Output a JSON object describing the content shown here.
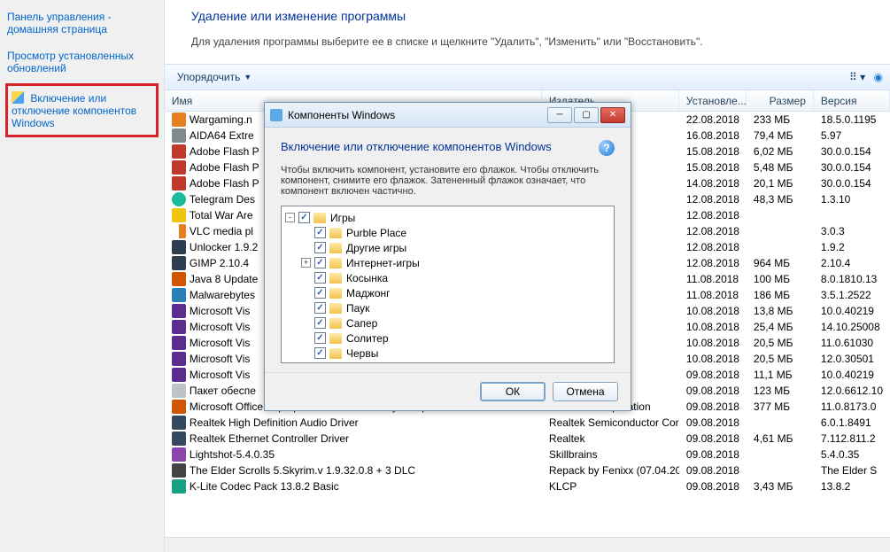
{
  "sidebar": {
    "home": "Панель управления - домашняя страница",
    "updates": "Просмотр установленных обновлений",
    "features": "Включение или отключение компонентов Windows"
  },
  "page": {
    "heading": "Удаление или изменение программы",
    "subhead": "Для удаления программы выберите ее в списке и щелкните \"Удалить\", \"Изменить\" или \"Восстановить\"."
  },
  "toolbar": {
    "organize": "Упорядочить"
  },
  "columns": {
    "name": "Имя",
    "publisher": "Издатель",
    "date": "Установле...",
    "size": "Размер",
    "version": "Версия"
  },
  "programs": [
    {
      "ico": "ic-orange",
      "name": "Wargaming.n",
      "pub": "",
      "date": "22.08.2018",
      "size": "233 МБ",
      "ver": "18.5.0.1195"
    },
    {
      "ico": "ic-grey",
      "name": "AIDA64 Extre",
      "pub": "",
      "date": "16.08.2018",
      "size": "79,4 МБ",
      "ver": "5.97"
    },
    {
      "ico": "ic-red",
      "name": "Adobe Flash P",
      "pub": "ated",
      "date": "15.08.2018",
      "size": "6,02 МБ",
      "ver": "30.0.0.154"
    },
    {
      "ico": "ic-red",
      "name": "Adobe Flash P",
      "pub": "",
      "date": "15.08.2018",
      "size": "5,48 МБ",
      "ver": "30.0.0.154"
    },
    {
      "ico": "ic-red",
      "name": "Adobe Flash P",
      "pub": "ated",
      "date": "14.08.2018",
      "size": "20,1 МБ",
      "ver": "30.0.0.154"
    },
    {
      "ico": "ic-teal",
      "name": "Telegram Des",
      "pub": "",
      "date": "12.08.2018",
      "size": "48,3 МБ",
      "ver": "1.3.10"
    },
    {
      "ico": "ic-yellow",
      "name": "Total War Are",
      "pub": "",
      "date": "12.08.2018",
      "size": "",
      "ver": ""
    },
    {
      "ico": "ic-vlc",
      "name": "VLC media pl",
      "pub": "",
      "date": "12.08.2018",
      "size": "",
      "ver": "3.0.3"
    },
    {
      "ico": "ic-dark",
      "name": "Unlocker 1.9.2",
      "pub": "",
      "date": "12.08.2018",
      "size": "",
      "ver": "1.9.2"
    },
    {
      "ico": "ic-dark",
      "name": "GIMP 2.10.4",
      "pub": "",
      "date": "12.08.2018",
      "size": "964 МБ",
      "ver": "2.10.4"
    },
    {
      "ico": "ic-java",
      "name": "Java 8 Update",
      "pub": "",
      "date": "11.08.2018",
      "size": "100 МБ",
      "ver": "8.0.1810.13"
    },
    {
      "ico": "ic-mwb",
      "name": "Malwarebytes",
      "pub": "",
      "date": "11.08.2018",
      "size": "186 МБ",
      "ver": "3.5.1.2522"
    },
    {
      "ico": "ic-vs",
      "name": "Microsoft Vis",
      "pub": "",
      "date": "10.08.2018",
      "size": "13,8 МБ",
      "ver": "10.0.40219"
    },
    {
      "ico": "ic-vs",
      "name": "Microsoft Vis",
      "pub": "",
      "date": "10.08.2018",
      "size": "25,4 МБ",
      "ver": "14.10.25008"
    },
    {
      "ico": "ic-vs",
      "name": "Microsoft Vis",
      "pub": "",
      "date": "10.08.2018",
      "size": "20,5 МБ",
      "ver": "11.0.61030"
    },
    {
      "ico": "ic-vs",
      "name": "Microsoft Vis",
      "pub": "фт",
      "date": "10.08.2018",
      "size": "20,5 МБ",
      "ver": "12.0.30501"
    },
    {
      "ico": "ic-vs",
      "name": "Microsoft Vis",
      "pub": "",
      "date": "09.08.2018",
      "size": "11,1 МБ",
      "ver": "10.0.40219"
    },
    {
      "ico": "ic-generic",
      "name": "Пакет обеспе",
      "pub": "",
      "date": "09.08.2018",
      "size": "123 МБ",
      "ver": "12.0.6612.10"
    },
    {
      "ico": "ic-office",
      "name": "Microsoft Office - профессиональный выпуск версии 2003",
      "pub": "Microsoft Corporation",
      "date": "09.08.2018",
      "size": "377 МБ",
      "ver": "11.0.8173.0"
    },
    {
      "ico": "ic-realtek",
      "name": "Realtek High Definition Audio Driver",
      "pub": "Realtek Semiconductor Corp.",
      "date": "09.08.2018",
      "size": "",
      "ver": "6.0.1.8491"
    },
    {
      "ico": "ic-realtek",
      "name": "Realtek Ethernet Controller Driver",
      "pub": "Realtek",
      "date": "09.08.2018",
      "size": "4,61 МБ",
      "ver": "7.112.811.2"
    },
    {
      "ico": "ic-ls",
      "name": "Lightshot-5.4.0.35",
      "pub": "Skillbrains",
      "date": "09.08.2018",
      "size": "",
      "ver": "5.4.0.35"
    },
    {
      "ico": "ic-sky",
      "name": "The Elder Scrolls 5.Skyrim.v 1.9.32.0.8 + 3 DLC",
      "pub": "Repack by Fenixx (07.04.2013)",
      "date": "09.08.2018",
      "size": "",
      "ver": "The Elder S"
    },
    {
      "ico": "ic-kl",
      "name": "K-Lite Codec Pack 13.8.2 Basic",
      "pub": "KLCP",
      "date": "09.08.2018",
      "size": "3,43 МБ",
      "ver": "13.8.2"
    }
  ],
  "dialog": {
    "title": "Компоненты Windows",
    "heading": "Включение или отключение компонентов Windows",
    "desc": "Чтобы включить компонент, установите его флажок. Чтобы отключить компонент, снимите его флажок. Затененный флажок означает, что компонент включен частично.",
    "ok": "ОК",
    "cancel": "Отмена",
    "tree": [
      {
        "lvl": 0,
        "exp": "-",
        "chk": true,
        "label": "Игры"
      },
      {
        "lvl": 1,
        "exp": "",
        "chk": true,
        "label": "Purble Place"
      },
      {
        "lvl": 1,
        "exp": "",
        "chk": true,
        "label": "Другие игры"
      },
      {
        "lvl": 1,
        "exp": "+",
        "chk": true,
        "label": "Интернет-игры"
      },
      {
        "lvl": 1,
        "exp": "",
        "chk": true,
        "label": "Косынка"
      },
      {
        "lvl": 1,
        "exp": "",
        "chk": true,
        "label": "Маджонг"
      },
      {
        "lvl": 1,
        "exp": "",
        "chk": true,
        "label": "Паук"
      },
      {
        "lvl": 1,
        "exp": "",
        "chk": true,
        "label": "Сапер"
      },
      {
        "lvl": 1,
        "exp": "",
        "chk": true,
        "label": "Солитер"
      },
      {
        "lvl": 1,
        "exp": "",
        "chk": true,
        "label": "Червы"
      }
    ]
  }
}
